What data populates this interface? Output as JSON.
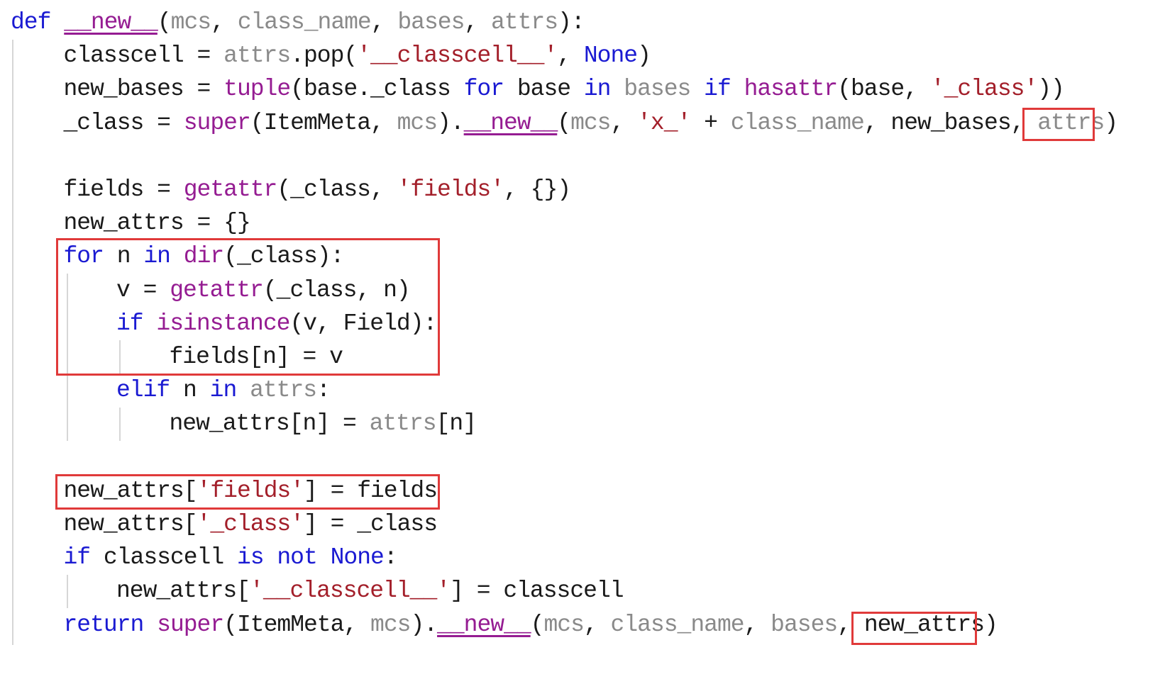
{
  "code": {
    "lines": [
      {
        "indent": 0,
        "tokens": [
          {
            "t": "def",
            "c": "kw"
          },
          {
            "t": " ",
            "c": "txt"
          },
          {
            "t": "__new__",
            "c": "dun"
          },
          {
            "t": "(",
            "c": "pun"
          },
          {
            "t": "mcs",
            "c": "arg"
          },
          {
            "t": ", ",
            "c": "pun"
          },
          {
            "t": "class_name",
            "c": "arg"
          },
          {
            "t": ", ",
            "c": "pun"
          },
          {
            "t": "bases",
            "c": "arg"
          },
          {
            "t": ", ",
            "c": "pun"
          },
          {
            "t": "attrs",
            "c": "arg"
          },
          {
            "t": "):",
            "c": "pun"
          }
        ]
      },
      {
        "indent": 1,
        "tokens": [
          {
            "t": "classcell = ",
            "c": "txt"
          },
          {
            "t": "attrs",
            "c": "arg"
          },
          {
            "t": ".pop(",
            "c": "txt"
          },
          {
            "t": "'__classcell__'",
            "c": "str"
          },
          {
            "t": ", ",
            "c": "pun"
          },
          {
            "t": "None",
            "c": "kw"
          },
          {
            "t": ")",
            "c": "pun"
          }
        ]
      },
      {
        "indent": 1,
        "tokens": [
          {
            "t": "new_bases = ",
            "c": "txt"
          },
          {
            "t": "tuple",
            "c": "bi"
          },
          {
            "t": "(base._class ",
            "c": "txt"
          },
          {
            "t": "for",
            "c": "kw"
          },
          {
            "t": " base ",
            "c": "txt"
          },
          {
            "t": "in",
            "c": "kw"
          },
          {
            "t": " ",
            "c": "txt"
          },
          {
            "t": "bases",
            "c": "arg"
          },
          {
            "t": " ",
            "c": "txt"
          },
          {
            "t": "if",
            "c": "kw"
          },
          {
            "t": " ",
            "c": "txt"
          },
          {
            "t": "hasattr",
            "c": "bi"
          },
          {
            "t": "(base, ",
            "c": "txt"
          },
          {
            "t": "'_class'",
            "c": "str"
          },
          {
            "t": "))",
            "c": "pun"
          }
        ]
      },
      {
        "indent": 1,
        "tokens": [
          {
            "t": "_class = ",
            "c": "txt"
          },
          {
            "t": "super",
            "c": "bi"
          },
          {
            "t": "(ItemMeta, ",
            "c": "txt"
          },
          {
            "t": "mcs",
            "c": "arg"
          },
          {
            "t": ").",
            "c": "pun"
          },
          {
            "t": "__new__",
            "c": "dun"
          },
          {
            "t": "(",
            "c": "pun"
          },
          {
            "t": "mcs",
            "c": "arg"
          },
          {
            "t": ", ",
            "c": "pun"
          },
          {
            "t": "'x_'",
            "c": "str"
          },
          {
            "t": " + ",
            "c": "txt"
          },
          {
            "t": "class_name",
            "c": "arg"
          },
          {
            "t": ", new_bases, ",
            "c": "txt"
          },
          {
            "t": "attrs",
            "c": "arg"
          },
          {
            "t": ")",
            "c": "pun"
          }
        ]
      },
      {
        "indent": 0,
        "tokens": []
      },
      {
        "indent": 1,
        "tokens": [
          {
            "t": "fields = ",
            "c": "txt"
          },
          {
            "t": "getattr",
            "c": "bi"
          },
          {
            "t": "(_class, ",
            "c": "txt"
          },
          {
            "t": "'fields'",
            "c": "str"
          },
          {
            "t": ", {})",
            "c": "txt"
          }
        ]
      },
      {
        "indent": 1,
        "tokens": [
          {
            "t": "new_attrs = {}",
            "c": "txt"
          }
        ]
      },
      {
        "indent": 1,
        "tokens": [
          {
            "t": "for",
            "c": "kw"
          },
          {
            "t": " n ",
            "c": "txt"
          },
          {
            "t": "in",
            "c": "kw"
          },
          {
            "t": " ",
            "c": "txt"
          },
          {
            "t": "dir",
            "c": "bi"
          },
          {
            "t": "(_class):",
            "c": "txt"
          }
        ]
      },
      {
        "indent": 2,
        "tokens": [
          {
            "t": "v = ",
            "c": "txt"
          },
          {
            "t": "getattr",
            "c": "bi"
          },
          {
            "t": "(_class, n)",
            "c": "txt"
          }
        ]
      },
      {
        "indent": 2,
        "tokens": [
          {
            "t": "if",
            "c": "kw"
          },
          {
            "t": " ",
            "c": "txt"
          },
          {
            "t": "isinstance",
            "c": "bi"
          },
          {
            "t": "(v, Field):",
            "c": "txt"
          }
        ]
      },
      {
        "indent": 3,
        "tokens": [
          {
            "t": "fields[n] = v",
            "c": "txt"
          }
        ]
      },
      {
        "indent": 2,
        "tokens": [
          {
            "t": "elif",
            "c": "kw"
          },
          {
            "t": " n ",
            "c": "txt"
          },
          {
            "t": "in",
            "c": "kw"
          },
          {
            "t": " ",
            "c": "txt"
          },
          {
            "t": "attrs",
            "c": "arg"
          },
          {
            "t": ":",
            "c": "pun"
          }
        ]
      },
      {
        "indent": 3,
        "tokens": [
          {
            "t": "new_attrs[n] = ",
            "c": "txt"
          },
          {
            "t": "attrs",
            "c": "arg"
          },
          {
            "t": "[n]",
            "c": "txt"
          }
        ]
      },
      {
        "indent": 0,
        "tokens": []
      },
      {
        "indent": 1,
        "tokens": [
          {
            "t": "new_attrs[",
            "c": "txt"
          },
          {
            "t": "'fields'",
            "c": "str"
          },
          {
            "t": "] = fields",
            "c": "txt"
          }
        ]
      },
      {
        "indent": 1,
        "tokens": [
          {
            "t": "new_attrs[",
            "c": "txt"
          },
          {
            "t": "'_class'",
            "c": "str"
          },
          {
            "t": "] = _class",
            "c": "txt"
          }
        ]
      },
      {
        "indent": 1,
        "tokens": [
          {
            "t": "if",
            "c": "kw"
          },
          {
            "t": " classcell ",
            "c": "txt"
          },
          {
            "t": "is",
            "c": "kw"
          },
          {
            "t": " ",
            "c": "txt"
          },
          {
            "t": "not",
            "c": "kw"
          },
          {
            "t": " ",
            "c": "txt"
          },
          {
            "t": "None",
            "c": "kw"
          },
          {
            "t": ":",
            "c": "pun"
          }
        ]
      },
      {
        "indent": 2,
        "tokens": [
          {
            "t": "new_attrs[",
            "c": "txt"
          },
          {
            "t": "'__classcell__'",
            "c": "str"
          },
          {
            "t": "] = classcell",
            "c": "txt"
          }
        ]
      },
      {
        "indent": 1,
        "tokens": [
          {
            "t": "return",
            "c": "kw"
          },
          {
            "t": " ",
            "c": "txt"
          },
          {
            "t": "super",
            "c": "bi"
          },
          {
            "t": "(ItemMeta, ",
            "c": "txt"
          },
          {
            "t": "mcs",
            "c": "arg"
          },
          {
            "t": ").",
            "c": "pun"
          },
          {
            "t": "__new__",
            "c": "dun"
          },
          {
            "t": "(",
            "c": "pun"
          },
          {
            "t": "mcs",
            "c": "arg"
          },
          {
            "t": ", ",
            "c": "pun"
          },
          {
            "t": "class_name",
            "c": "arg"
          },
          {
            "t": ", ",
            "c": "pun"
          },
          {
            "t": "bases",
            "c": "arg"
          },
          {
            "t": ", ",
            "c": "pun"
          },
          {
            "t": "new_attrs",
            "c": "txt"
          },
          {
            "t": ")",
            "c": "pun"
          }
        ]
      }
    ]
  },
  "colors": {
    "keyword": "#1a1ad2",
    "builtin": "#951c92",
    "string": "#a31f2a",
    "argument": "#8a8a8a",
    "text": "#1a1a1a",
    "highlight_box": "#e03a3a",
    "indent_guide": "#d6d6d6"
  }
}
